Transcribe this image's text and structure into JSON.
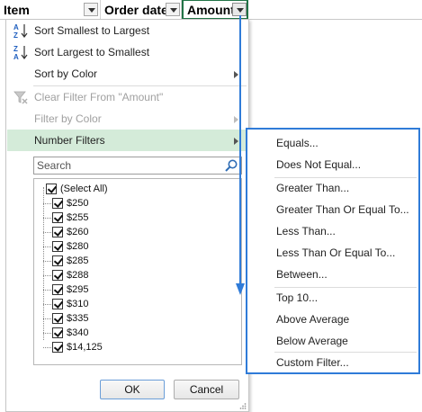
{
  "header": {
    "columns": [
      {
        "label": "Item"
      },
      {
        "label": "Order date"
      },
      {
        "label": "Amount"
      }
    ]
  },
  "menu": {
    "sort_asc": "Sort Smallest to Largest",
    "sort_desc": "Sort Largest to Smallest",
    "sort_color": "Sort by Color",
    "clear_filter": "Clear Filter From \"Amount\"",
    "filter_color": "Filter by Color",
    "number_filters": "Number Filters",
    "search_placeholder": "Search",
    "values": [
      "(Select All)",
      "$250",
      "$255",
      "$260",
      "$280",
      "$285",
      "$288",
      "$295",
      "$310",
      "$335",
      "$340",
      "$14,125"
    ],
    "ok_label": "OK",
    "cancel_label": "Cancel"
  },
  "submenu": {
    "equals": "Equals...",
    "not_equal": "Does Not Equal...",
    "greater": "Greater Than...",
    "greater_eq": "Greater Than Or Equal To...",
    "less": "Less Than...",
    "less_eq": "Less Than Or Equal To...",
    "between": "Between...",
    "top10": "Top 10...",
    "above_avg": "Above Average",
    "below_avg": "Below Average",
    "custom": "Custom Filter..."
  },
  "colors": {
    "highlight": "#d4ebd9",
    "submenu_border": "#2f7bd8",
    "selected_cell": "#217346"
  }
}
